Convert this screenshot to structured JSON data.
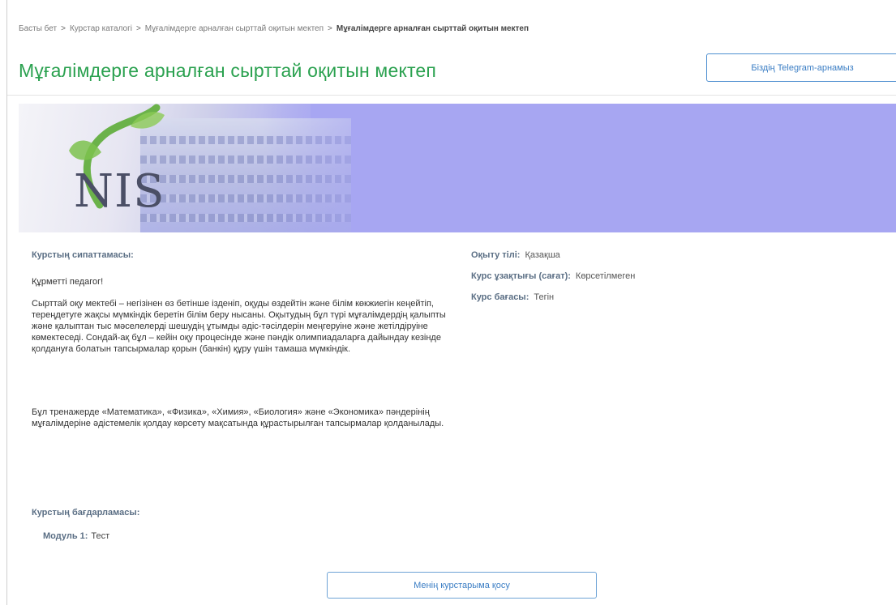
{
  "breadcrumb": {
    "items": [
      "Басты бет",
      "Курстар каталогі",
      "Мұғалімдерге арналған сырттай оқитын мектеп",
      "Мұғалімдерге арналған сырттай оқитын мектеп"
    ],
    "separator": ">"
  },
  "header": {
    "title": "Мұғалімдерге арналған сырттай оқитын мектеп",
    "telegram_button": "Біздің Telegram-арнамыз"
  },
  "banner": {
    "logo_text": "NIS"
  },
  "description": {
    "label": "Курстың сипаттамасы:",
    "greeting": "Құрметті педагог!",
    "paragraph1": "Сырттай оқу мектебі – негізінен өз бетінше ізденіп, оқуды өздейтін және білім көкжиегін кеңейтіп, тереңдетуге жақсы мүмкіндік беретін білім беру нысаны. Оқытудың бұл түрі мұғалімдердің қалыпты және қалыптан тыс мәселелерді шешудің ұтымды әдіс-тәсілдерін меңгеруіне және жетілдіруіне көмектеседі. Сондай-ақ бұл – кейін оқу процесінде және пәндік олимпиадаларға дайындау кезінде қолдануға болатын тапсырмалар қорын (банкін) құру үшін тамаша мүмкіндік.",
    "paragraph2": "Бұл тренажерде «Математика», «Физика», «Химия», «Биология» және «Экономика» пәндерінің мұғалімдеріне әдістемелік қолдау көрсету мақсатында құрастырылған тапсырмалар қолданылады."
  },
  "info": {
    "language_label": "Оқыту тілі:",
    "language_value": "Қазақша",
    "duration_label": "Курс ұзақтығы (сағат):",
    "duration_value": "Көрсетілмеген",
    "price_label": "Курс бағасы:",
    "price_value": "Тегін"
  },
  "program": {
    "label": "Курстың бағдарламасы:",
    "modules": [
      {
        "label": "Модуль 1:",
        "value": "Тест"
      }
    ]
  },
  "actions": {
    "enroll_button": "Менің курстарыма қосу"
  },
  "colors": {
    "title_green": "#2aa14f",
    "button_blue": "#3a7dc4",
    "banner_lavender": "#a7a6f2",
    "label_slate": "#5a6e84"
  }
}
